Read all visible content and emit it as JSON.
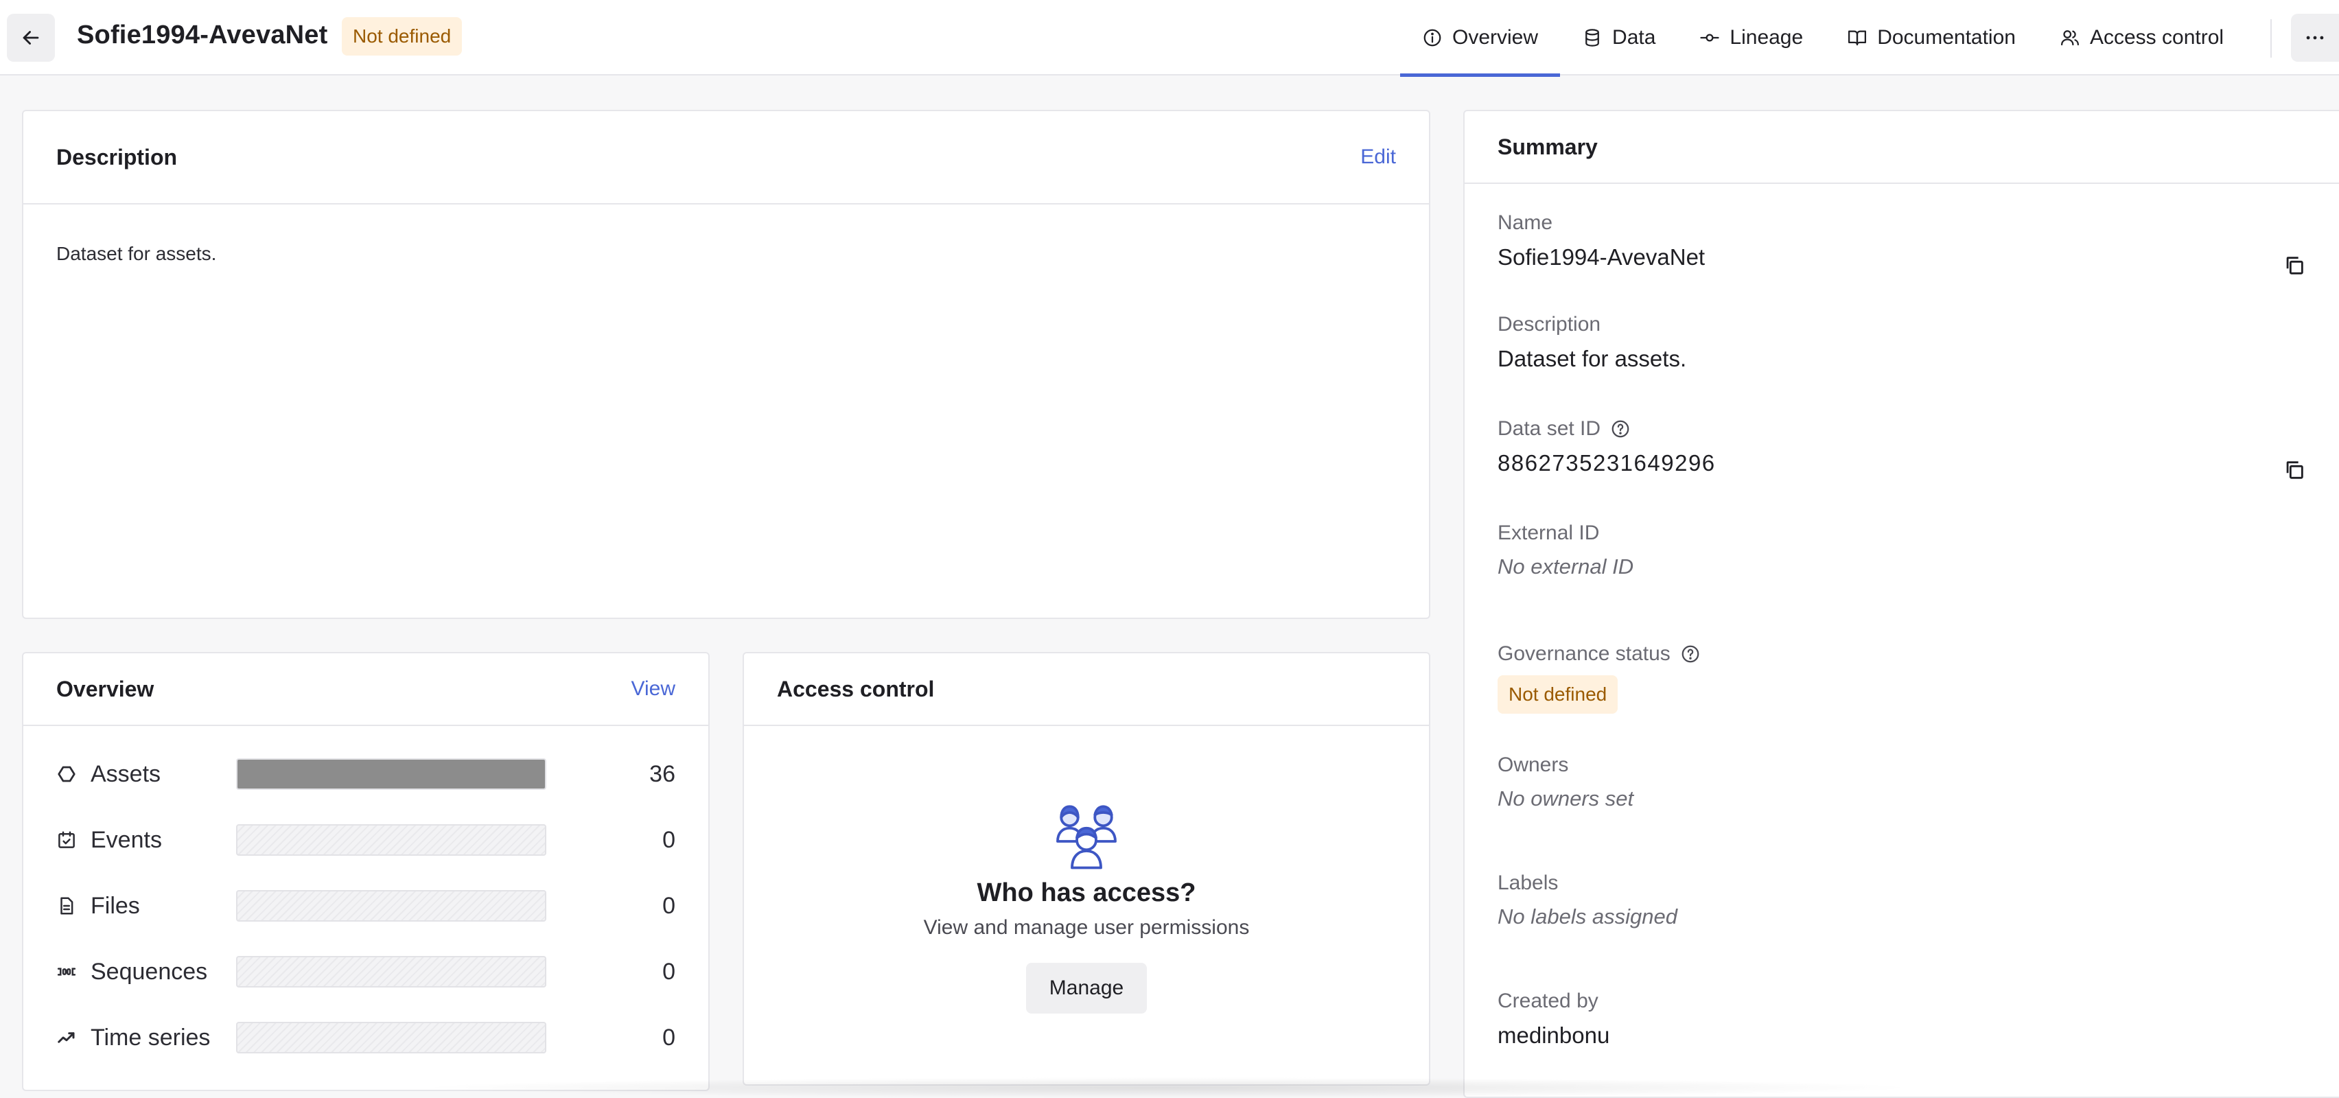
{
  "header": {
    "title": "Sofie1994-AvevaNet",
    "status_badge": "Not defined",
    "tabs": [
      {
        "label": "Overview",
        "icon": "info-icon",
        "active": true
      },
      {
        "label": "Data",
        "icon": "database-icon"
      },
      {
        "label": "Lineage",
        "icon": "lineage-icon"
      },
      {
        "label": "Documentation",
        "icon": "book-icon"
      },
      {
        "label": "Access control",
        "icon": "users-icon"
      }
    ]
  },
  "description_card": {
    "title": "Description",
    "edit_label": "Edit",
    "text": "Dataset for assets."
  },
  "overview_card": {
    "title": "Overview",
    "view_label": "View",
    "rows": [
      {
        "label": "Assets",
        "icon": "asset-icon",
        "count": "36",
        "fill": 1.0
      },
      {
        "label": "Events",
        "icon": "calendar-icon",
        "count": "0",
        "fill": 0
      },
      {
        "label": "Files",
        "icon": "file-icon",
        "count": "0",
        "fill": 0
      },
      {
        "label": "Sequences",
        "icon": "sequence-icon",
        "count": "0",
        "fill": 0
      },
      {
        "label": "Time series",
        "icon": "timeseries-icon",
        "count": "0",
        "fill": 0
      }
    ]
  },
  "access_card": {
    "title": "Access control",
    "heading": "Who has access?",
    "subtext": "View and manage user permissions",
    "manage_label": "Manage"
  },
  "summary": {
    "title": "Summary",
    "name_label": "Name",
    "name_value": "Sofie1994-AvevaNet",
    "description_label": "Description",
    "description_value": "Dataset for assets.",
    "dataset_id_label": "Data set ID",
    "dataset_id_value": "8862735231649296",
    "external_id_label": "External ID",
    "external_id_value": "No external ID",
    "governance_label": "Governance status",
    "governance_value": "Not defined",
    "owners_label": "Owners",
    "owners_value": "No owners set",
    "labels_label": "Labels",
    "labels_value": "No labels assigned",
    "created_by_label": "Created by",
    "created_by_value": "medinbonu"
  },
  "colors": {
    "accent": "#4a67d6",
    "badge_bg": "#fff1de",
    "badge_text": "#9a5a00",
    "bar_fill": "#8c8c8c"
  }
}
